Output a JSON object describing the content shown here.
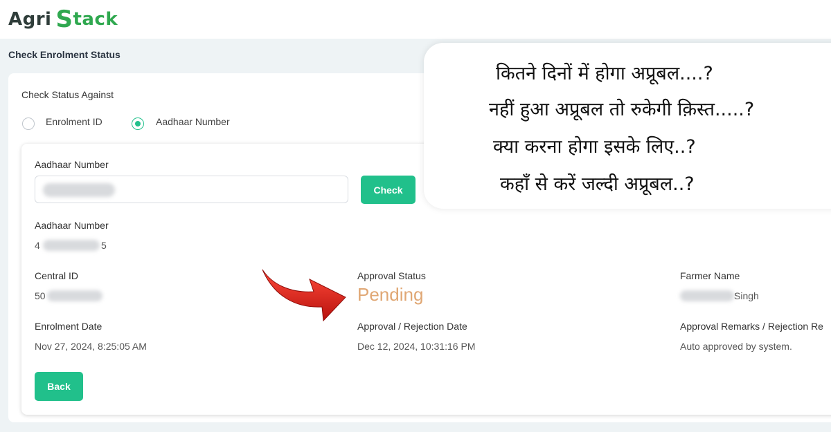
{
  "logo": {
    "part1": "Agri",
    "part2": "S",
    "part3": "tack"
  },
  "page": {
    "title": "Check Enrolment Status"
  },
  "form": {
    "check_against_label": "Check Status Against",
    "radio_enrolment_label": "Enrolment ID",
    "radio_aadhaar_label": "Aadhaar Number",
    "selected": "Aadhaar Number",
    "aadhaar_field_label": "Aadhaar Number",
    "aadhaar_input_value": "",
    "check_button": "Check"
  },
  "result": {
    "aadhaar_label": "Aadhaar Number",
    "aadhaar_prefix": "4",
    "aadhaar_suffix": "5",
    "central_id_label": "Central ID",
    "central_id_prefix": "50",
    "approval_status_label": "Approval Status",
    "approval_status_value": "Pending",
    "farmer_name_label": "Farmer Name",
    "farmer_name_suffix": "Singh",
    "enrolment_date_label": "Enrolment Date",
    "enrolment_date_value": "Nov 27, 2024, 8:25:05 AM",
    "approval_date_label": "Approval / Rejection Date",
    "approval_date_value": "Dec 12, 2024, 10:31:16 PM",
    "remarks_label": "Approval Remarks / Rejection Re",
    "remarks_value": "Auto approved by system.",
    "back_button": "Back"
  },
  "overlay": {
    "line1": "कितने दिनों में होगा अप्रूबल....?",
    "line2": "नहीं हुआ अप्रूबल तो रुकेगी क़िस्त.....?",
    "line3": "क्या करना होगा इसके लिए..?",
    "line4": "कहाँ से करें जल्दी अप्रूबल..?"
  },
  "colors": {
    "accent": "#21c08b",
    "pending": "#e0a774",
    "arrow": "#e02020",
    "brand": "#2fa84f"
  }
}
